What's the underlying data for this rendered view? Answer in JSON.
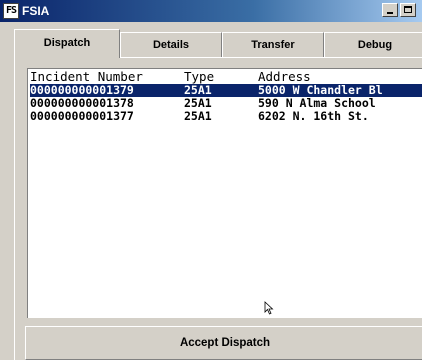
{
  "window": {
    "icon_letters": "FS",
    "title": "FSIA",
    "minimize_icon": "minimize-icon",
    "maximize_icon": "maximize-icon"
  },
  "tabs": [
    {
      "label": "Dispatch",
      "active": true
    },
    {
      "label": "Details",
      "active": false
    },
    {
      "label": "Transfer",
      "active": false
    },
    {
      "label": "Debug",
      "active": false
    }
  ],
  "incident_list": {
    "headers": {
      "number": "Incident Number",
      "type": "Type",
      "address": "Address"
    },
    "rows": [
      {
        "number": "000000000001379",
        "type": "25A1",
        "address": "5000 W Chandler Bl",
        "selected": true
      },
      {
        "number": "000000000001378",
        "type": "25A1",
        "address": "590 N Alma School",
        "selected": false
      },
      {
        "number": "000000000001377",
        "type": "25A1",
        "address": "6202 N. 16th St.",
        "selected": false
      }
    ]
  },
  "accept_button": {
    "label": "Accept Dispatch"
  },
  "colors": {
    "selection": "#0a246a",
    "face": "#d4d0c8",
    "list_background": "#ffffff"
  }
}
